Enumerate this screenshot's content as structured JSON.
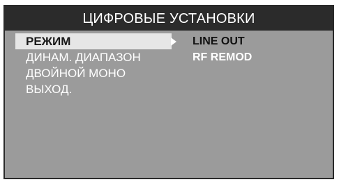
{
  "title": "ЦИФРОВЫЕ УСТАНОВКИ",
  "menu": {
    "items": [
      {
        "label": "РЕЖИМ",
        "selected": true
      },
      {
        "label": "ДИНАМ. ДИАПАЗОН",
        "selected": false
      },
      {
        "label": "ДВОЙНОЙ МОНО",
        "selected": false
      },
      {
        "label": "ВЫХОД.",
        "selected": false
      }
    ]
  },
  "options": {
    "items": [
      {
        "label": "LINE OUT",
        "active": true
      },
      {
        "label": "RF REMOD",
        "active": false
      }
    ]
  },
  "icons": {
    "submenu_arrow": "triangle-right-icon"
  },
  "colors": {
    "panel_bg": "#9b9b9b",
    "title_bg": "#2b2b2b",
    "highlight_bg": "#e6e6e6",
    "text_light": "#ffffff",
    "text_dark": "#111111"
  }
}
